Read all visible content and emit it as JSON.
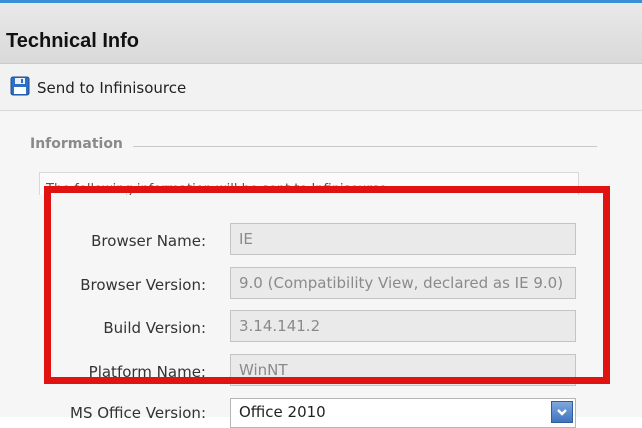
{
  "header": {
    "title": "Technical Info"
  },
  "toolbar": {
    "send_label": "Send to Infinisource",
    "send_icon": "save-icon"
  },
  "section": {
    "legend": "Information",
    "notice": "The following information will be sent to Infinisource."
  },
  "fields": [
    {
      "label": "Browser Name:",
      "value": "IE"
    },
    {
      "label": "Browser Version:",
      "value": "9.0 (Compatibility View, declared as IE 9.0)"
    },
    {
      "label": "Build Version:",
      "value": "3.14.141.2"
    },
    {
      "label": "Platform Name:",
      "value": "WinNT"
    }
  ],
  "office": {
    "label": "MS Office Version:",
    "value": "Office 2010"
  },
  "colors": {
    "highlight": "#e01212",
    "accent": "#3a8fd6"
  }
}
